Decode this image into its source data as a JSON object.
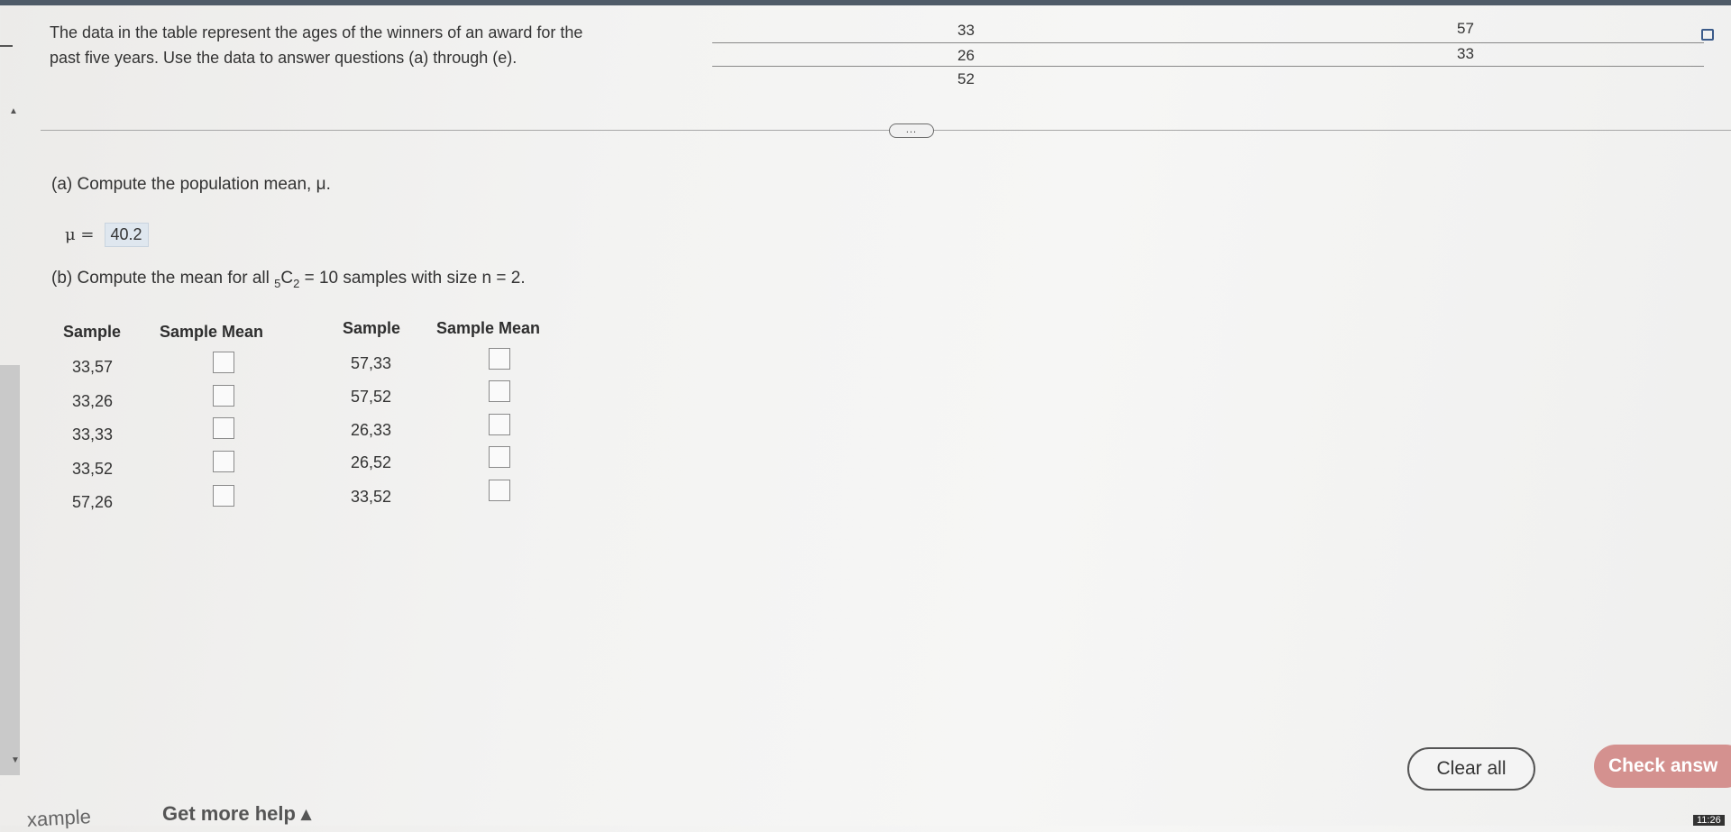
{
  "prompt": {
    "line1": "The data in the table represent the ages of the winners of an award for the",
    "line2": "past five years. Use the data to answer questions (a) through (e)."
  },
  "data_table": {
    "col1": [
      "33",
      "26",
      "52"
    ],
    "col2": [
      "57",
      "33"
    ]
  },
  "more_button": "...",
  "part_a": {
    "question": "(a) Compute the population mean, μ.",
    "mu_label": "μ =",
    "mu_value": "40.2"
  },
  "part_b": {
    "question_prefix": "(b) Compute the mean for all ",
    "combo_sub1": "5",
    "combo_letter": "C",
    "combo_sub2": "2",
    "question_suffix": " = 10 samples with size n = 2."
  },
  "samples_table": {
    "headers": {
      "left_sample": "Sample",
      "left_mean": "Sample Mean",
      "right_sample": "Sample",
      "right_mean": "Sample Mean"
    },
    "left": [
      "33,57",
      "33,26",
      "33,33",
      "33,52",
      "57,26"
    ],
    "right": [
      "57,33",
      "57,52",
      "26,33",
      "26,52",
      "33,52"
    ]
  },
  "buttons": {
    "clear_all": "Clear all",
    "check_answer": "Check answ"
  },
  "footer": {
    "get_more_help": "Get more help ▴",
    "example": "xample",
    "clock": "11:26"
  },
  "icons": [
    "square-icon",
    "caret-up-icon",
    "caret-down-icon"
  ],
  "colors": {
    "check_button": "#d4918f",
    "answer_box": "#dfe7ef"
  }
}
